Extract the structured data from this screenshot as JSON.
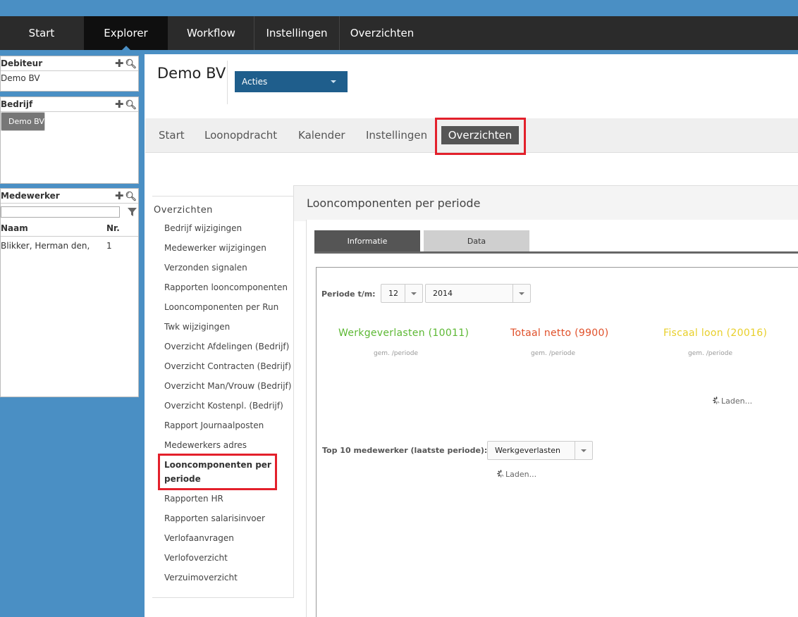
{
  "topnav": {
    "items": [
      "Start",
      "Explorer",
      "Workflow",
      "Instellingen",
      "Overzichten"
    ],
    "active": "Explorer"
  },
  "debiteur": {
    "title": "Debiteur",
    "rows": [
      {
        "name": "Demo BV"
      }
    ]
  },
  "bedrijf": {
    "title": "Bedrijf",
    "rows": [
      {
        "name": "Demo BV",
        "nr": "1"
      }
    ]
  },
  "medewerker": {
    "title": "Medewerker",
    "search_value": "",
    "col_name": "Naam",
    "col_nr": "Nr.",
    "rows": [
      {
        "name": "Blikker, Herman den,",
        "nr": "1"
      }
    ]
  },
  "company": {
    "name": "Demo BV",
    "actions_label": "Acties"
  },
  "subnav": {
    "items": [
      "Start",
      "Loonopdracht",
      "Kalender",
      "Instellingen",
      "Overzichten"
    ],
    "active": "Overzichten"
  },
  "menu": {
    "title": "Overzichten",
    "items": [
      "Bedrijf wijzigingen",
      "Medewerker wijzigingen",
      "Verzonden signalen",
      "Rapporten looncomponenten",
      "Looncomponenten per Run",
      "Twk wijzigingen",
      "Overzicht Afdelingen (Bedrijf)",
      "Overzicht Contracten (Bedrijf)",
      "Overzicht Man/Vrouw (Bedrijf)",
      "Overzicht Kostenpl. (Bedrijf)",
      "Rapport Journaalposten",
      "Medewerkers adres",
      "Looncomponenten per",
      "periode",
      "Rapporten HR",
      "Rapporten salarisinvoer",
      "Verlofaanvragen",
      "Verlofoverzicht",
      "Verzuimoverzicht"
    ]
  },
  "content": {
    "title": "Looncomponenten per periode",
    "tabs": [
      "Informatie",
      "Data"
    ],
    "periode_label": "Periode t/m:",
    "periode_month": "12",
    "periode_year": "2014",
    "kpis": [
      {
        "label": "Werkgeverlasten (10011)",
        "sub": "gem. /periode",
        "color": "#5cb833"
      },
      {
        "label": "Totaal netto (9900)",
        "sub": "gem. /periode",
        "color": "#e0502a"
      },
      {
        "label": "Fiscaal loon (20016)",
        "sub": "gem. /periode",
        "color": "#e8cf2a"
      }
    ],
    "loading_text": "Laden...",
    "top10_label": "Top 10 medewerker (laatste periode):",
    "top10_value": "Werkgeverlasten"
  },
  "colors": {
    "accent_blue": "#4a8fc4",
    "actions_blue": "#1f5e8c",
    "highlight_red": "#e3202b",
    "topnav_bg": "#2b2b2b"
  }
}
